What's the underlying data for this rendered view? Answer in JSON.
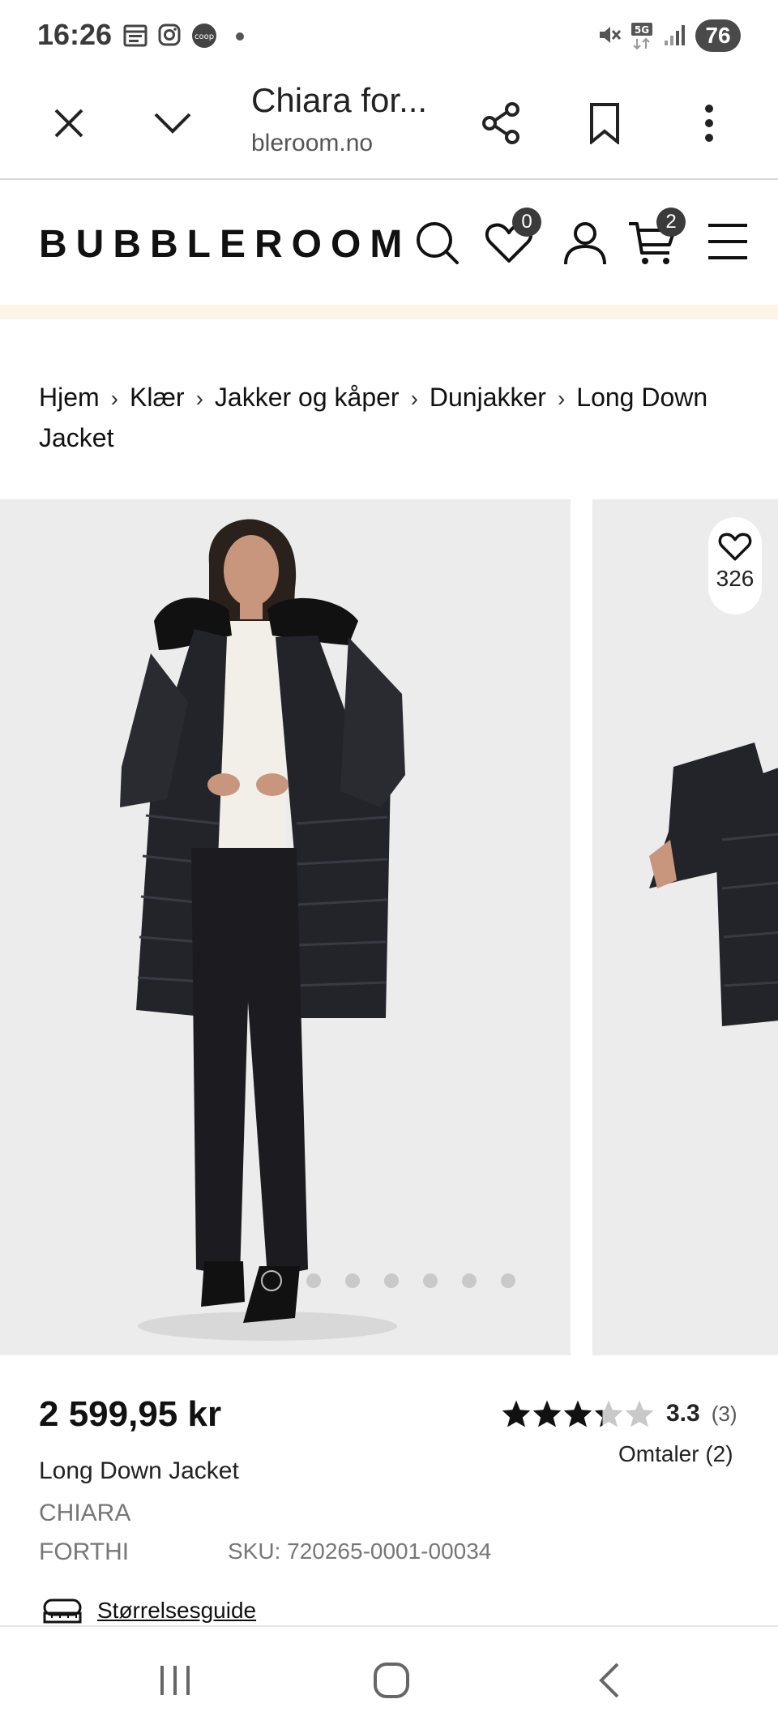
{
  "status_bar": {
    "time": "16:26",
    "battery": "76",
    "icons": [
      "calendar-icon",
      "instagram-icon",
      "coop-icon",
      "mute-icon",
      "5g-icon",
      "signal-icon"
    ]
  },
  "browser": {
    "title": "Chiara for...",
    "url": "bleroom.no"
  },
  "site": {
    "logo": "BUBBLEROOM",
    "wishlist_count": "0",
    "cart_count": "2"
  },
  "breadcrumb": {
    "items": [
      "Hjem",
      "Klær",
      "Jakker og kåper",
      "Dunjakker",
      "Long Down Jacket"
    ]
  },
  "gallery": {
    "favorite_count": "326",
    "image_count": 7,
    "active_index": 0,
    "background_color": "#ececec"
  },
  "product": {
    "price": "2 599,95 kr",
    "name": "Long Down Jacket",
    "brand_line1": "CHIARA",
    "brand_line2": "FORTHI",
    "sku": "SKU: 720265-0001-00034",
    "rating_value": "3.3",
    "rating_stars": 3.3,
    "rating_count": "(3)",
    "reviews_link": "Omtaler (2)",
    "size_guide": "Størrelsesguide"
  },
  "colors": {
    "promo_strip": "#fdf3e6",
    "badge": "#3b3b3b"
  }
}
